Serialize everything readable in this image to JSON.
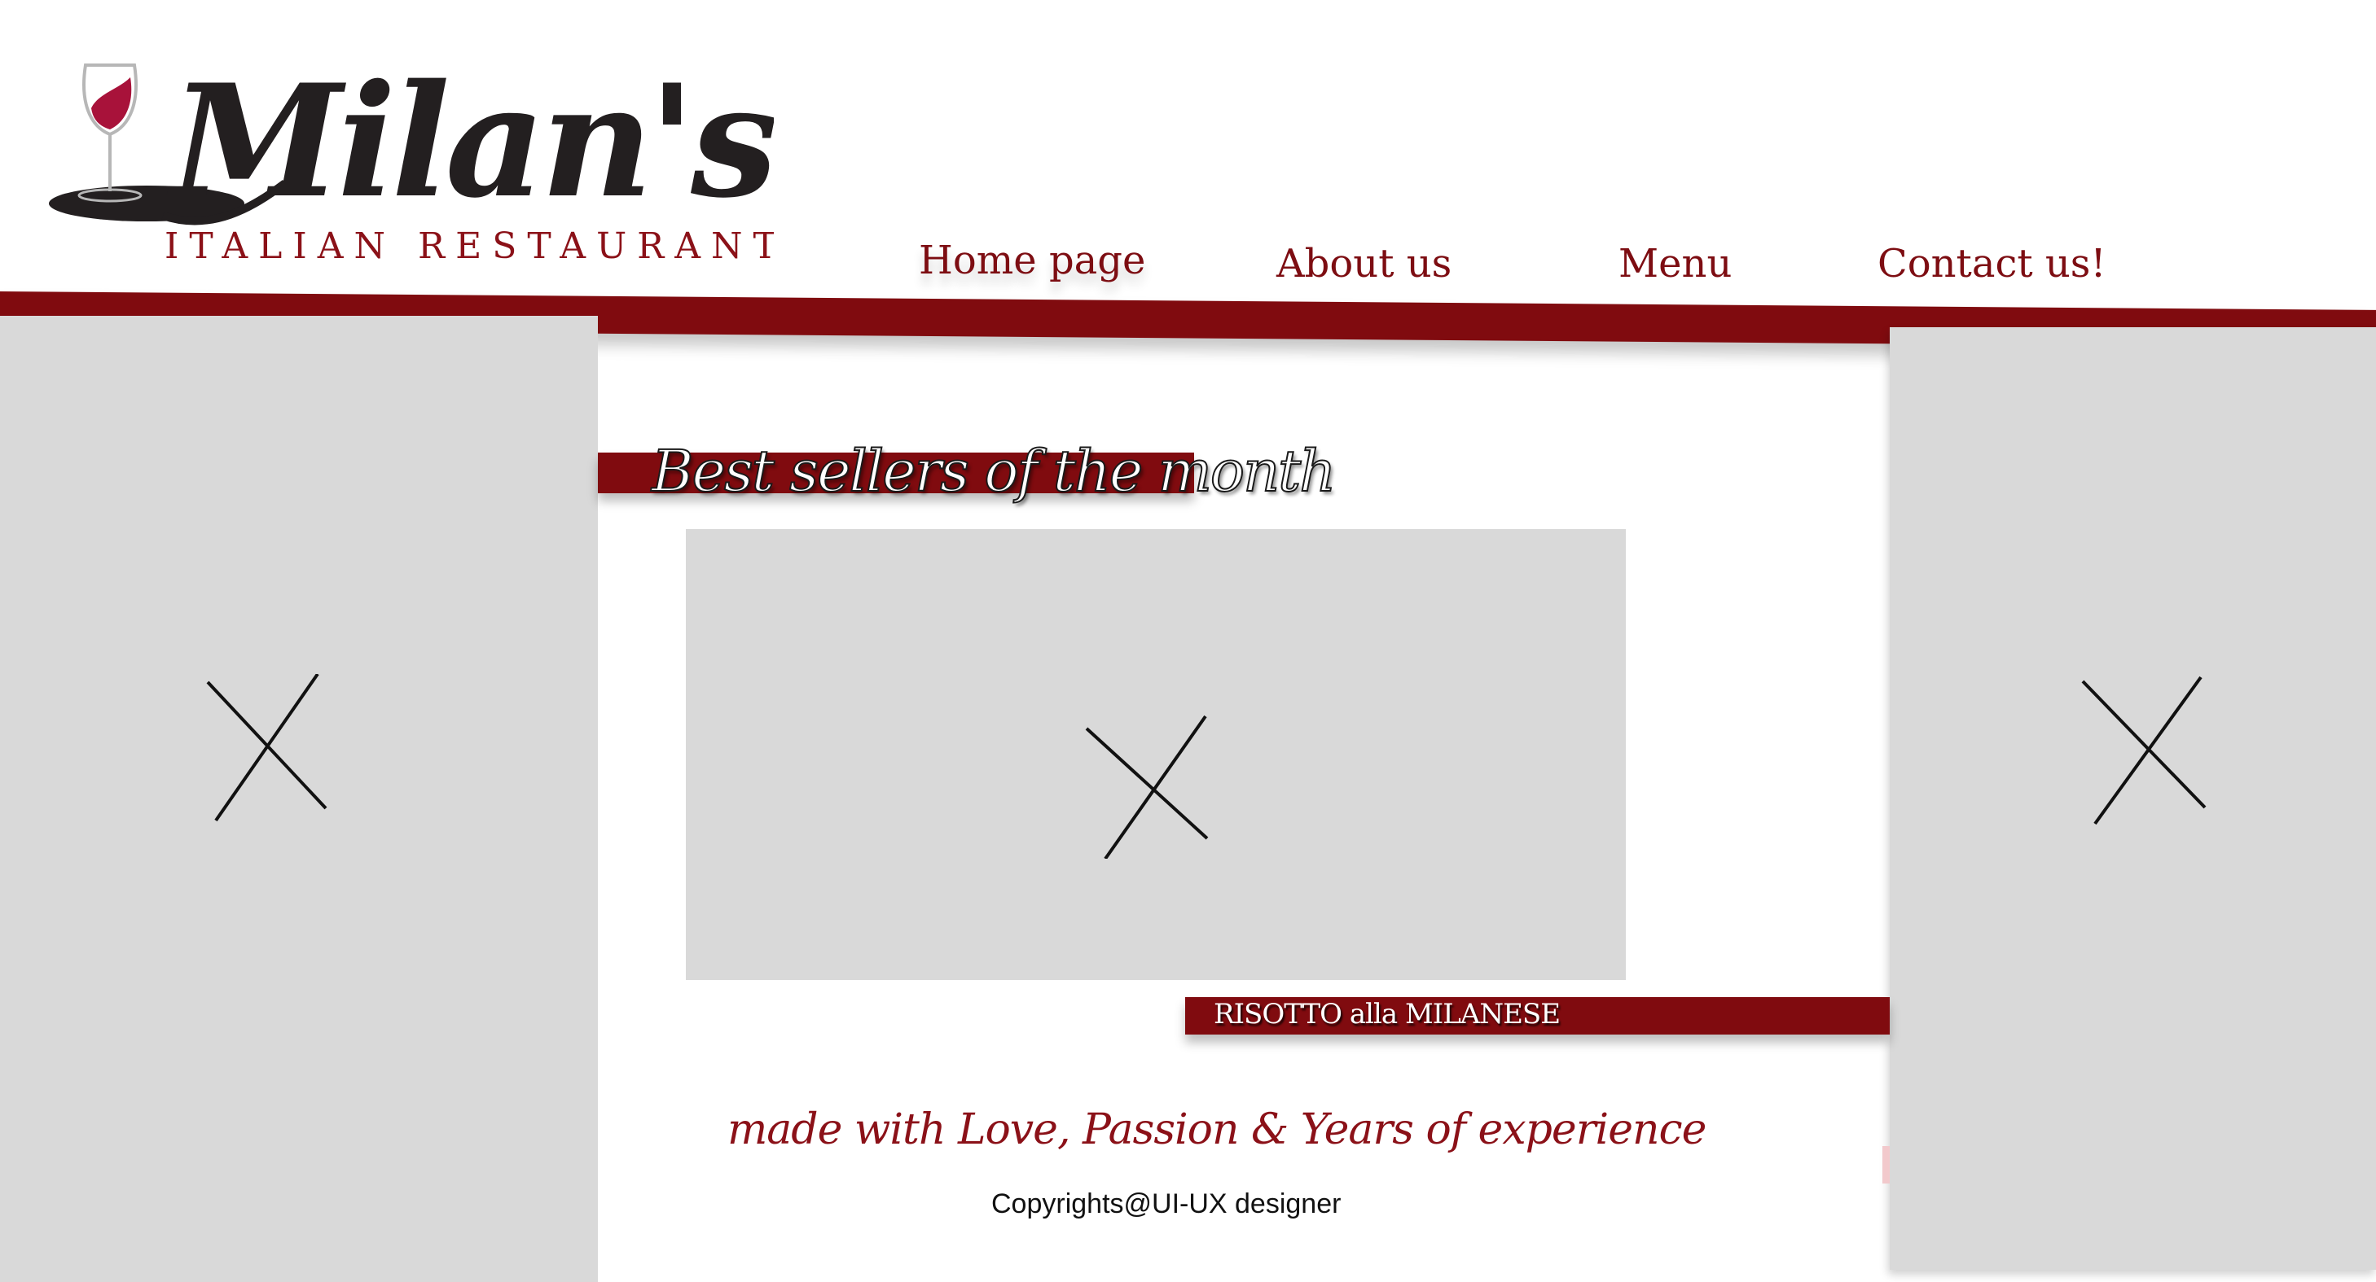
{
  "brand": {
    "name": "Milan's",
    "subtitle": "ITALIAN RESTAURANT",
    "colors": {
      "primary": "#800b0f",
      "wine": "#a8123a",
      "ink": "#231f20"
    }
  },
  "nav": {
    "items": [
      {
        "label": "Home page"
      },
      {
        "label": "About us"
      },
      {
        "label": "Menu"
      },
      {
        "label": "Contact us!"
      }
    ]
  },
  "main": {
    "section_title": "Best sellers of the month",
    "dish_name": "RISOTTO alla MILANESE",
    "tagline": "made with Love, Passion & Years of experience"
  },
  "footer": {
    "copyright": "Copyrights@UI-UX designer"
  },
  "icons": {
    "placeholder": "x-mark-icon",
    "logo": "wine-glass-icon"
  }
}
